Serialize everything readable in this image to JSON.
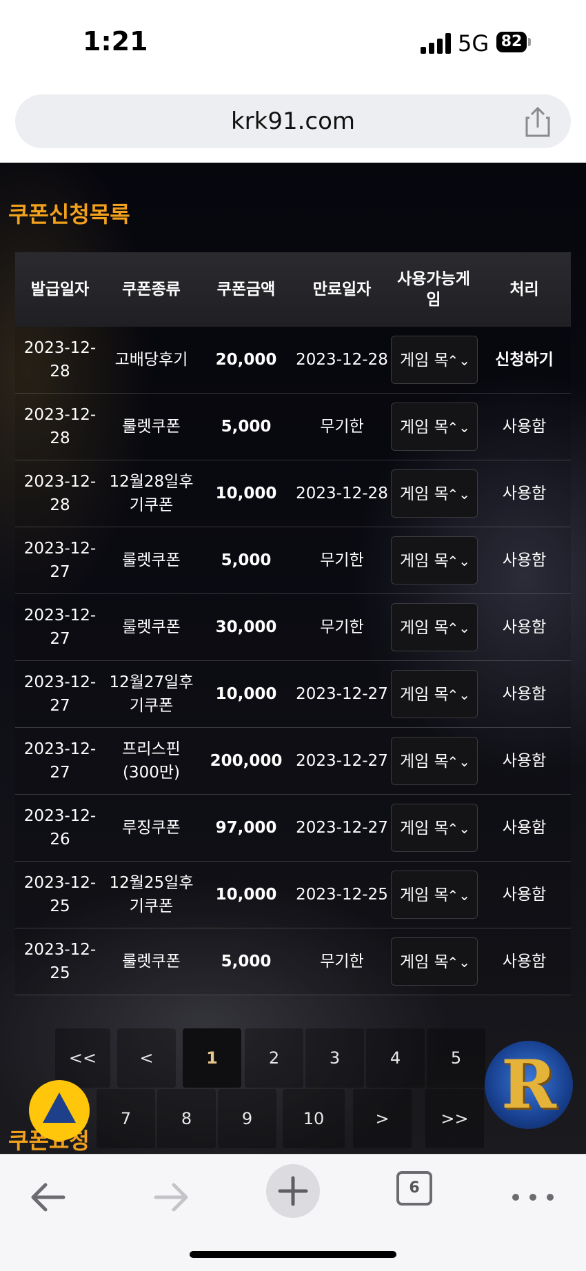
{
  "status_bar": {
    "time": "1:21",
    "network": "5G",
    "battery": "82"
  },
  "browser": {
    "url": "krk91.com",
    "tab_count": "6"
  },
  "section_title": "쿠폰신청목록",
  "table": {
    "headers": [
      "발급일자",
      "쿠폰종류",
      "쿠폰금액",
      "만료일자",
      "사용가능게임",
      "처리"
    ],
    "rows": [
      {
        "issued": "2023-12-28",
        "type": "고배당후기",
        "amount": "20,000",
        "expires": "2023-12-28",
        "game": "게임 목",
        "action": "신청하기"
      },
      {
        "issued": "2023-12-28",
        "type": "룰렛쿠폰",
        "amount": "5,000",
        "expires": "무기한",
        "game": "게임 목",
        "action": "사용함"
      },
      {
        "issued": "2023-12-28",
        "type": "12월28일후기쿠폰",
        "amount": "10,000",
        "expires": "2023-12-28",
        "game": "게임 목",
        "action": "사용함"
      },
      {
        "issued": "2023-12-27",
        "type": "룰렛쿠폰",
        "amount": "5,000",
        "expires": "무기한",
        "game": "게임 목",
        "action": "사용함"
      },
      {
        "issued": "2023-12-27",
        "type": "룰렛쿠폰",
        "amount": "30,000",
        "expires": "무기한",
        "game": "게임 목",
        "action": "사용함"
      },
      {
        "issued": "2023-12-27",
        "type": "12월27일후기쿠폰",
        "amount": "10,000",
        "expires": "2023-12-27",
        "game": "게임 목",
        "action": "사용함"
      },
      {
        "issued": "2023-12-27",
        "type": "프리스핀(300만)",
        "amount": "200,000",
        "expires": "2023-12-27",
        "game": "게임 목",
        "action": "사용함"
      },
      {
        "issued": "2023-12-26",
        "type": "루징쿠폰",
        "amount": "97,000",
        "expires": "2023-12-27",
        "game": "게임 목",
        "action": "사용함"
      },
      {
        "issued": "2023-12-25",
        "type": "12월25일후기쿠폰",
        "amount": "10,000",
        "expires": "2023-12-25",
        "game": "게임 목",
        "action": "사용함"
      },
      {
        "issued": "2023-12-25",
        "type": "룰렛쿠폰",
        "amount": "5,000",
        "expires": "무기한",
        "game": "게임 목",
        "action": "사용함"
      }
    ]
  },
  "pagination": {
    "row1": [
      "<<",
      "<",
      "1",
      "2",
      "3",
      "4",
      "5"
    ],
    "row2": [
      "7",
      "8",
      "9",
      "10",
      ">",
      ">>"
    ],
    "current": "1"
  },
  "floating": {
    "logo_letter": "R"
  },
  "bottom_section_title": "쿠폰요청"
}
